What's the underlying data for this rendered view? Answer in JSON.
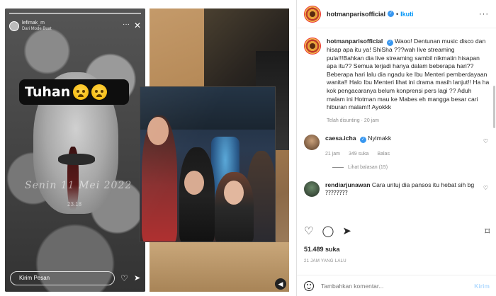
{
  "story": {
    "username": "lefimak_m",
    "subtitle": "Dari Mode Buat",
    "sticker_text": "Tuhan",
    "signature": "Senin 11 Mei 2022",
    "time": "23.18",
    "reply_placeholder": "Kirim Pesan"
  },
  "post": {
    "username": "hotmanparisofficial",
    "follow_label": "Ikuti",
    "caption_user": "hotmanparisofficial",
    "caption": "Waoo! Dentunan music disco dan hisap apa itu ya! ShiSha ???wah live streaming pula!!!Bahkan dia live streaming sambil nikmatin hisapan apa itu?? Semua terjadi hanya dalam beberapa hari?? Beberapa hari lalu dia ngadu ke Ibu Menteri pemberdayaan wanita!! Halo Ibu Menteri lihat ini drama masih lanjut!! Ha ha kok pengacaranya belum konprensi pers lagi ?? Aduh malam ini Hotman mau ke Mabes eh mangga besar cari hiburan malam!! Ayokkk",
    "caption_meta": "Telah disunting · 20 jam",
    "comments": [
      {
        "user": "caesa.icha",
        "text": "Nyimakk ",
        "time": "21 jam",
        "likes": "349 suka",
        "reply": "Balas",
        "view_replies": "Lihat balasan (15)"
      },
      {
        "user": "rendiarjunawan",
        "text": "Cara untuj dia pansos itu hebat sih bg ⁇⁇⁇⁇"
      }
    ],
    "likes": "51.489 suka",
    "timestamp": "21 JAM YANG LALU",
    "add_comment_placeholder": "Tambahkan komentar...",
    "post_label": "Kirim"
  },
  "colors": {
    "accent": "#0095f6",
    "verified": "#3897f0",
    "muted": "#8e8e8e"
  }
}
